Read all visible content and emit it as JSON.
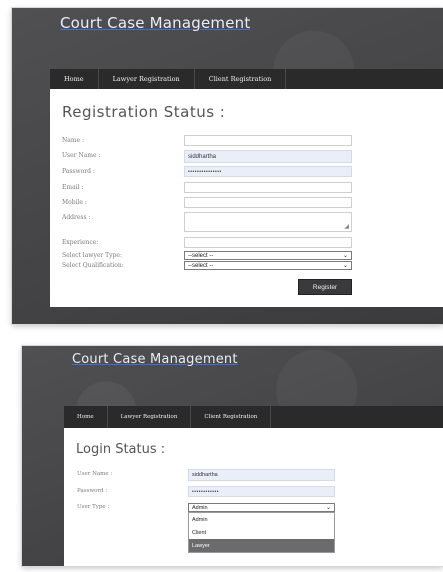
{
  "registration": {
    "site_title": "Court Case Management",
    "nav": [
      "Home",
      "Lawyer Registration",
      "Client Registration"
    ],
    "heading": "Registration Status :",
    "fields": {
      "name_label": "Name :",
      "username_label": "User Name :",
      "username_value": "siddhartha",
      "password_label": "Password :",
      "password_value": "•••••••••••••••",
      "email_label": "Email :",
      "mobile_label": "Mobile :",
      "address_label": "Address :",
      "experience_label": "Experience:",
      "lawyer_type_label": "Select lawyer Type:",
      "lawyer_type_value": "--select --",
      "qualification_label": "Select Qualification:",
      "qualification_value": "--select --"
    },
    "register_button": "Register"
  },
  "login": {
    "site_title": "Court Case Management",
    "nav": [
      "Home",
      "Lawyer Registration",
      "Client Registration"
    ],
    "heading": "Login Status :",
    "fields": {
      "username_label": "User Name :",
      "username_value": "siddhartha",
      "password_label": "Password :",
      "password_value": "••••••••••••",
      "usertype_label": "User Type :",
      "usertype_value": "Admin"
    },
    "usertype_options": [
      "Admin",
      "Client",
      "Lawyer"
    ],
    "usertype_highlighted": "Lawyer"
  }
}
